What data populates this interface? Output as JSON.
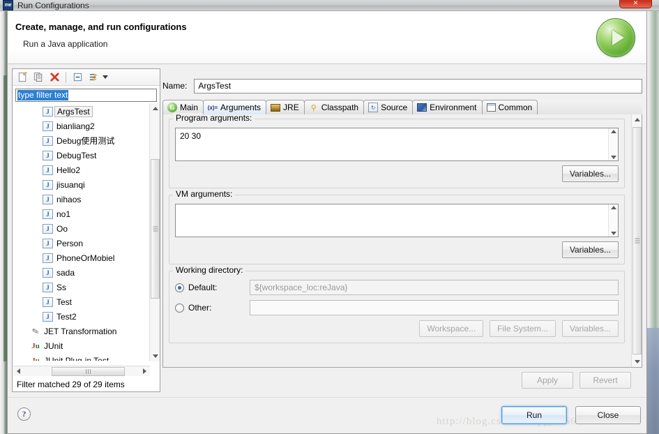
{
  "window": {
    "title": "Run Configurations",
    "icon_label": "me",
    "close_glyph": "✕"
  },
  "header": {
    "title": "Create, manage, and run configurations",
    "subtitle": "Run a Java application"
  },
  "tree_toolbar": {
    "new_label": "New launch configuration",
    "duplicate_label": "Duplicate",
    "delete_label": "Delete",
    "collapse_label": "Collapse All",
    "filter_label": "Filter launch configurations"
  },
  "filter": {
    "value": "type filter text",
    "status": "Filter matched 29 of 29 items"
  },
  "tree": {
    "items": [
      {
        "label": "ArgsTest",
        "icon": "java-app-icon",
        "level": "child",
        "selected": true
      },
      {
        "label": "bianliang2",
        "icon": "java-app-icon",
        "level": "child",
        "selected": false
      },
      {
        "label": "Debug使用测试",
        "icon": "java-app-icon",
        "level": "child",
        "selected": false
      },
      {
        "label": "DebugTest",
        "icon": "java-app-icon",
        "level": "child",
        "selected": false
      },
      {
        "label": "Hello2",
        "icon": "java-app-icon",
        "level": "child",
        "selected": false
      },
      {
        "label": "jisuanqi",
        "icon": "java-app-icon",
        "level": "child",
        "selected": false
      },
      {
        "label": "nihaos",
        "icon": "java-app-icon",
        "level": "child",
        "selected": false
      },
      {
        "label": "no1",
        "icon": "java-app-icon",
        "level": "child",
        "selected": false
      },
      {
        "label": "Oo",
        "icon": "java-app-icon",
        "level": "child",
        "selected": false
      },
      {
        "label": "Person",
        "icon": "java-app-icon",
        "level": "child",
        "selected": false
      },
      {
        "label": "PhoneOrMobiel",
        "icon": "java-app-icon",
        "level": "child",
        "selected": false
      },
      {
        "label": "sada",
        "icon": "java-app-icon",
        "level": "child",
        "selected": false
      },
      {
        "label": "Ss",
        "icon": "java-app-icon",
        "level": "child",
        "selected": false
      },
      {
        "label": "Test",
        "icon": "java-app-icon",
        "level": "child",
        "selected": false
      },
      {
        "label": "Test2",
        "icon": "java-app-icon",
        "level": "child",
        "selected": false
      },
      {
        "label": "JET Transformation",
        "icon": "jet-icon",
        "level": "top",
        "selected": false
      },
      {
        "label": "JUnit",
        "icon": "junit-icon",
        "level": "top",
        "selected": false
      },
      {
        "label": "JUnit Plug-in Test",
        "icon": "junit-plugin-icon",
        "level": "top",
        "selected": false
      }
    ],
    "java_icon_glyph": "J",
    "jet_icon_glyph": "✎",
    "junit_icon_j": "J",
    "junit_icon_u": "u"
  },
  "config": {
    "name_label": "Name:",
    "name_value": "ArgsTest"
  },
  "tabs": [
    {
      "label": "Main",
      "icon": "main-icon",
      "icon_glyph": "G",
      "active": false
    },
    {
      "label": "Arguments",
      "icon": "arguments-icon",
      "icon_glyph": "(x)=",
      "active": true
    },
    {
      "label": "JRE",
      "icon": "jre-icon",
      "icon_glyph": "",
      "active": false
    },
    {
      "label": "Classpath",
      "icon": "classpath-icon",
      "icon_glyph": "⚲",
      "active": false
    },
    {
      "label": "Source",
      "icon": "source-icon",
      "icon_glyph": "↻",
      "active": false
    },
    {
      "label": "Environment",
      "icon": "environment-icon",
      "icon_glyph": "",
      "active": false
    },
    {
      "label": "Common",
      "icon": "common-icon",
      "icon_glyph": "",
      "active": false
    }
  ],
  "arguments_tab": {
    "program_arguments": {
      "legend": "Program arguments:",
      "value": "20 30",
      "variables_button": "Variables..."
    },
    "vm_arguments": {
      "legend": "VM arguments:",
      "value": "",
      "variables_button": "Variables..."
    },
    "working_directory": {
      "legend": "Working directory:",
      "default_radio_label": "Default:",
      "default_value": "${workspace_loc:reJava}",
      "default_selected": true,
      "other_radio_label": "Other:",
      "other_value": "",
      "other_selected": false,
      "workspace_button": "Workspace...",
      "file_system_button": "File System...",
      "variables_button": "Variables..."
    }
  },
  "form_buttons": {
    "apply": "Apply",
    "revert": "Revert",
    "apply_enabled": false,
    "revert_enabled": false
  },
  "dialog_buttons": {
    "help": "?",
    "run": "Run",
    "close": "Close"
  },
  "watermark": {
    "text": "http://blog.csdn.net/qq_36666268"
  },
  "colors": {
    "selection_blue": "#2a7fd4",
    "run_green": "#63b23c",
    "close_red": "#c9301c",
    "default_button_blue": "#5b9bd5"
  }
}
